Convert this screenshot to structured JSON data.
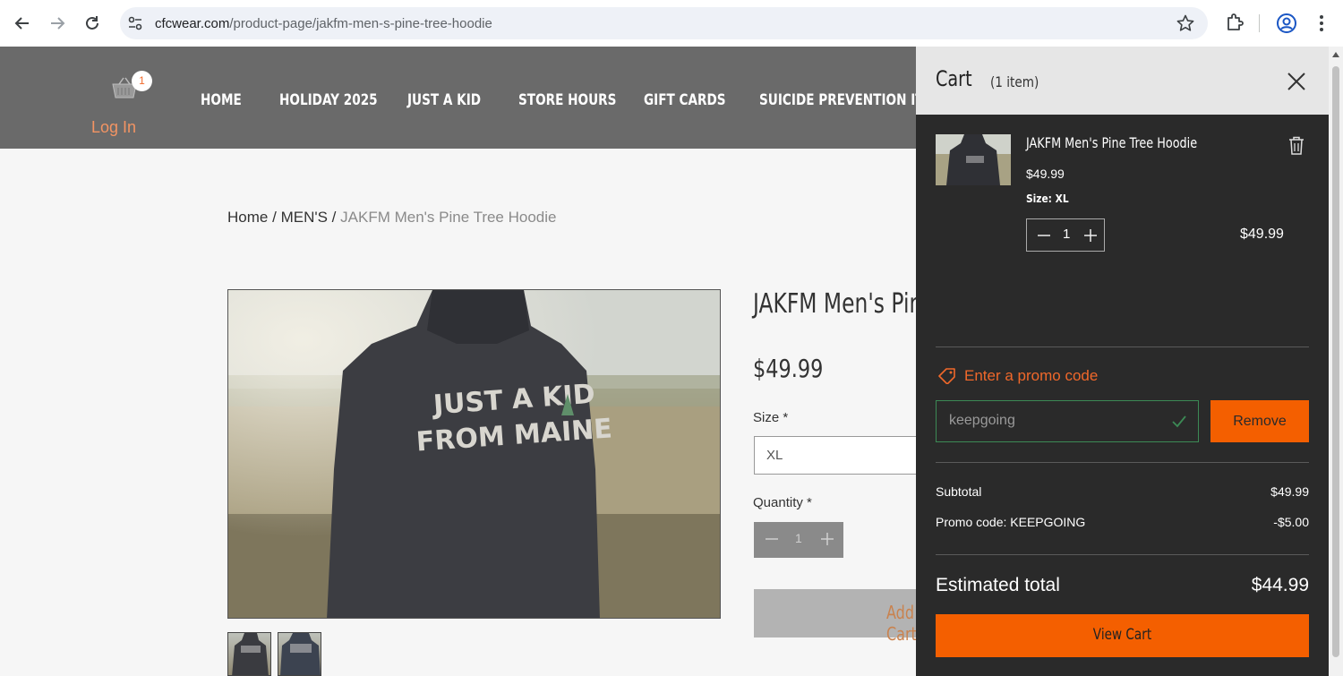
{
  "browser": {
    "url_host": "cfcwear.com",
    "url_path": "/product-page/jakfm-men-s-pine-tree-hoodie",
    "icons": [
      "back-icon",
      "forward-icon",
      "reload-icon",
      "site-info-icon",
      "star-icon",
      "extensions-icon",
      "profile-icon",
      "menu-icon"
    ]
  },
  "header": {
    "cart_count": "1",
    "login": "Log In",
    "nav": [
      "HOME",
      "HOLIDAY 2025",
      "JUST A KID",
      "STORE HOURS",
      "GIFT CARDS",
      "SUICIDE PREVENTION ITEMS"
    ],
    "background": "#6a6a6a",
    "accent": "#f39463"
  },
  "breadcrumb": {
    "home": "Home",
    "sep1": "/",
    "category": "MEN'S",
    "sep2": "/",
    "current": "JAKFM Men's Pine Tree Hoodie"
  },
  "product": {
    "title": "JAKFM Men's Pine Tree Hoodie",
    "price": "$49.99",
    "size_label": "Size *",
    "size_value": "XL",
    "quantity_label": "Quantity *",
    "quantity_value": "1",
    "add_button": "Add to Cart",
    "hoodie_text_line1": "JUST A KID",
    "hoodie_text_line2": "FROM MAINE"
  },
  "cart": {
    "title": "Cart",
    "count_label": "(1 item)",
    "item": {
      "name": "JAKFM Men's Pine Tree Hoodie",
      "price": "$49.99",
      "size": "Size: XL",
      "qty": "1",
      "line_total": "$49.99"
    },
    "promo_link": "Enter a promo code",
    "promo_value": "keepgoing",
    "remove_button": "Remove",
    "subtotal_label": "Subtotal",
    "subtotal_value": "$49.99",
    "promo_label": "Promo code: KEEPGOING",
    "promo_discount": "-$5.00",
    "estimated_label": "Estimated total",
    "estimated_value": "$44.99",
    "view_cart_button": "View Cart",
    "accent": "#f45f00",
    "panel_color": "#2a2a2a"
  }
}
